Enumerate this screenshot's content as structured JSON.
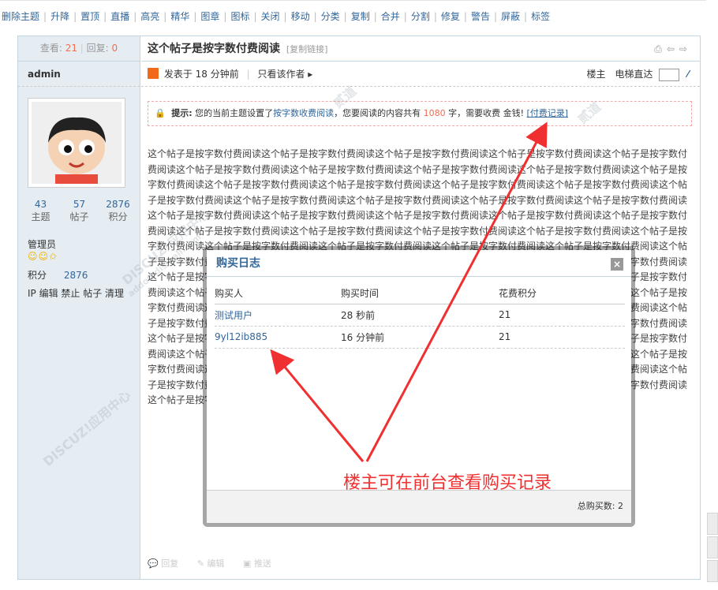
{
  "toolbar": {
    "items": [
      "删除主题",
      "升降",
      "置顶",
      "直播",
      "高亮",
      "精华",
      "图章",
      "图标",
      "关闭",
      "移动",
      "分类",
      "复制",
      "合并",
      "分割",
      "修复",
      "警告",
      "屏蔽",
      "标签"
    ]
  },
  "sidebar": {
    "views_label": "查看:",
    "views": "21",
    "replies_label": "回复:",
    "replies": "0",
    "author": "admin",
    "counts": [
      {
        "value": "43",
        "label": "主题"
      },
      {
        "value": "57",
        "label": "帖子"
      },
      {
        "value": "2876",
        "label": "积分"
      }
    ],
    "rank": "管理员",
    "points_label": "积分",
    "points_value": "2876",
    "admin_links": "IP 编辑 禁止 帖子 清理"
  },
  "post": {
    "title": "这个帖子是按字数付费阅读",
    "copy_link": "[复制链接]",
    "posted_at": "发表于 18 分钟前",
    "only_author": "只看该作者 ▸",
    "owner": "楼主",
    "jump_label": "电梯直达"
  },
  "notice": {
    "prefix": "提示:",
    "text1": "您的当前主题设置了",
    "mode": "按字数收费阅读",
    "text2": "，您要阅读的内容共有",
    "count": "1080",
    "text3": "字，需要收费 金钱!",
    "log_link": "[付费记录]"
  },
  "body": {
    "text": "这个帖子是按字数付费阅读这个帖子是按字数付费阅读这个帖子是按字数付费阅读这个帖子是按字数付费阅读这个帖子是按字数付费阅读这个帖子是按字数付费阅读这个帖子是按字数付费阅读这个帖子是按字数付费阅读这个帖子是按字数付费阅读这个帖子是按字数付费阅读这个帖子是按字数付费阅读这个帖子是按字数付费阅读这个帖子是按字数付费阅读这个帖子是按字数付费阅读这个帖子是按字数付费阅读这个帖子是按字数付费阅读这个帖子是按字数付费阅读这个帖子是按字数付费阅读这个帖子是按字数付费阅读这个帖子是按字数付费阅读这个帖子是按字数付费阅读这个帖子是按字数付费阅读这个帖子是按字数付费阅读这个帖子是按字数付费阅读这个帖子是按字数付费阅读这个帖子是按字数付费阅读这个帖子是按字数付费阅读这个帖子是按字数付费阅读这个帖子是按字数付费阅读这个帖子是按字数付费阅读这个帖子是按字数付费阅读这个帖子是按字数付费阅读这个帖子是按字数付费阅读这个帖子是按字数付费阅读这个帖子是按字数付费阅读这个帖子是按字数付费阅读这个帖子是按字数付费阅读这个帖子是按字数付费阅读这个帖子是按字数付费阅读这个帖子是按字数付费阅读这个帖子是按字数付费阅读这个帖子是按字数付费阅读这个帖子是按字数付费阅读这个帖子是按字数付费阅读这个帖子是按字数付费阅读这个帖子是按字数付费阅读这个帖子是按字数付费阅读这个帖子是按字数付费阅读这个帖子是按字数付费阅读这个帖子是按字数付费阅读这个帖子是按字数付费阅读这个帖子是按字数付费阅读这个帖子是按字数付费阅读这个帖子是按字数付费阅读这个帖子是按字数付费阅读这个帖子是按字数付费阅读这个帖子是按字数付费阅读这个帖子是按字数付费阅读这个帖子是按字数付费阅读这个帖子是按字数付费阅读这个帖子是按字数付费阅读这个帖子是按字数付费阅读这个帖子是按字数付费阅读这个帖子是按字数付费阅读这个帖子是按字数付费阅读这个帖子是按字数付费阅读这个帖子是按字数付费阅读这个帖子是按字数付费阅读这个帖子是按字数付费阅读这个帖子是按字数付费阅读这个帖子是按字数付费阅读这个帖子是按字数付费阅读这个帖子是按字数付费阅读这个帖子是按字数付费阅读这个帖子是按字数付费阅读这个帖子是按字数付费阅读这个帖子是按字数付费阅读"
  },
  "actions": {
    "reply": "回复",
    "edit": "编辑",
    "recommend": "推送"
  },
  "dialog": {
    "title": "购买日志",
    "close": "×",
    "headers": [
      "购买人",
      "购买时间",
      "花费积分"
    ],
    "rows": [
      {
        "buyer": "测试用户",
        "time": "28 秒前",
        "cost": "21"
      },
      {
        "buyer": "9yl12ib885",
        "time": "16 分钟前",
        "cost": "21"
      }
    ],
    "total": "总购买数: 2"
  },
  "annotation": {
    "text": "楼主可在前台查看购买记录",
    "color": "#f03030"
  },
  "watermark": {
    "brand": "DISCUZ!应用中心",
    "site": "addon.dismall.com",
    "tag": "贰道"
  }
}
